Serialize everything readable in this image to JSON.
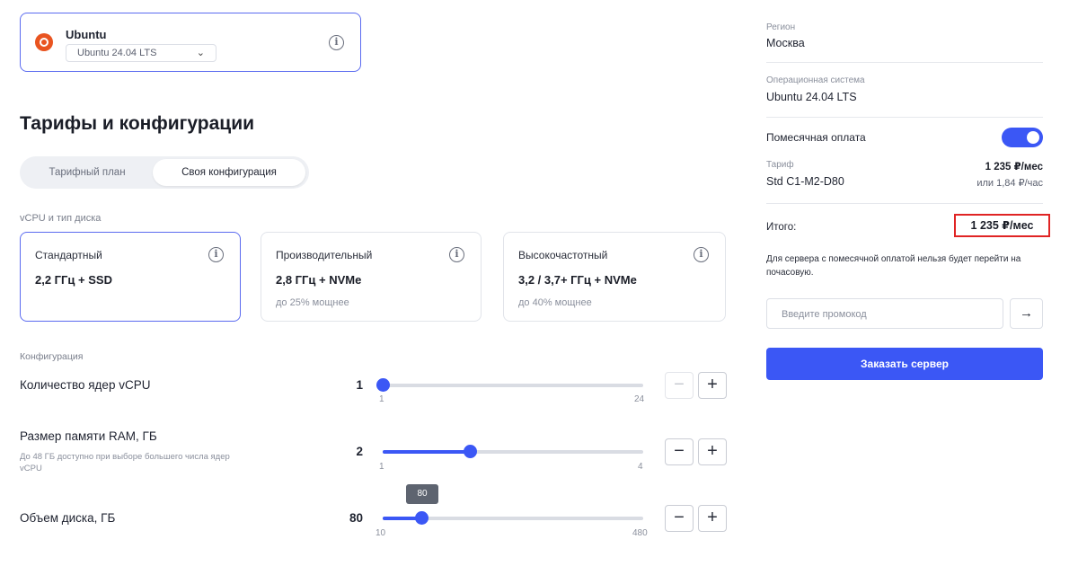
{
  "os": {
    "name": "Ubuntu",
    "version": "Ubuntu 24.04 LTS",
    "logo_color": "#e95420"
  },
  "section_title": "Тарифы и конфигурации",
  "tabs": [
    {
      "label": "Тарифный план",
      "active": false
    },
    {
      "label": "Своя конфигурация",
      "active": true
    }
  ],
  "disk_section_label": "vCPU и тип диска",
  "disk_types": [
    {
      "title": "Стандартный",
      "spec": "2,2 ГГц + SSD",
      "note": "",
      "selected": true
    },
    {
      "title": "Производительный",
      "spec": "2,8 ГГц + NVMe",
      "note": "до 25% мощнее",
      "selected": false
    },
    {
      "title": "Высокочастотный",
      "spec": "3,2 / 3,7+ ГГц + NVMe",
      "note": "до 40% мощнее",
      "selected": false
    }
  ],
  "config_label": "Конфигурация",
  "config": {
    "cpu": {
      "label": "Количество ядер vCPU",
      "value": "1",
      "min": "1",
      "max": "24",
      "level": 0.0
    },
    "ram": {
      "label": "Размер памяти RAM, ГБ",
      "sub": "До 48 ГБ доступно при выборе большего числа ядер vCPU",
      "value": "2",
      "min": "1",
      "max": "4",
      "level": 0.333
    },
    "disk": {
      "label": "Объем диска, ГБ",
      "value": "80",
      "min": "10",
      "max": "480",
      "tooltip": "80",
      "level": 0.149
    }
  },
  "stepper": {
    "minus": "−",
    "plus": "+"
  },
  "summary": {
    "region_label": "Регион",
    "region_value": "Москва",
    "os_label": "Операционная система",
    "os_value": "Ubuntu 24.04 LTS",
    "monthly_label": "Помесячная оплата",
    "monthly_enabled": true,
    "tariff_label": "Тариф",
    "tariff_value": "Std C1-M2-D80",
    "price_month": "1 235 ₽/мес",
    "price_hour": "или 1,84 ₽/час",
    "total_label": "Итого:",
    "total_value": "1 235 ₽/мес",
    "warning": "Для сервера с помесячной оплатой нельзя будет перейти на почасовую.",
    "promo_placeholder": "Введите промокод",
    "promo_arrow": "→",
    "order_button": "Заказать сервер"
  },
  "colors": {
    "accent": "#3b57f5",
    "highlight": "#e02424"
  }
}
